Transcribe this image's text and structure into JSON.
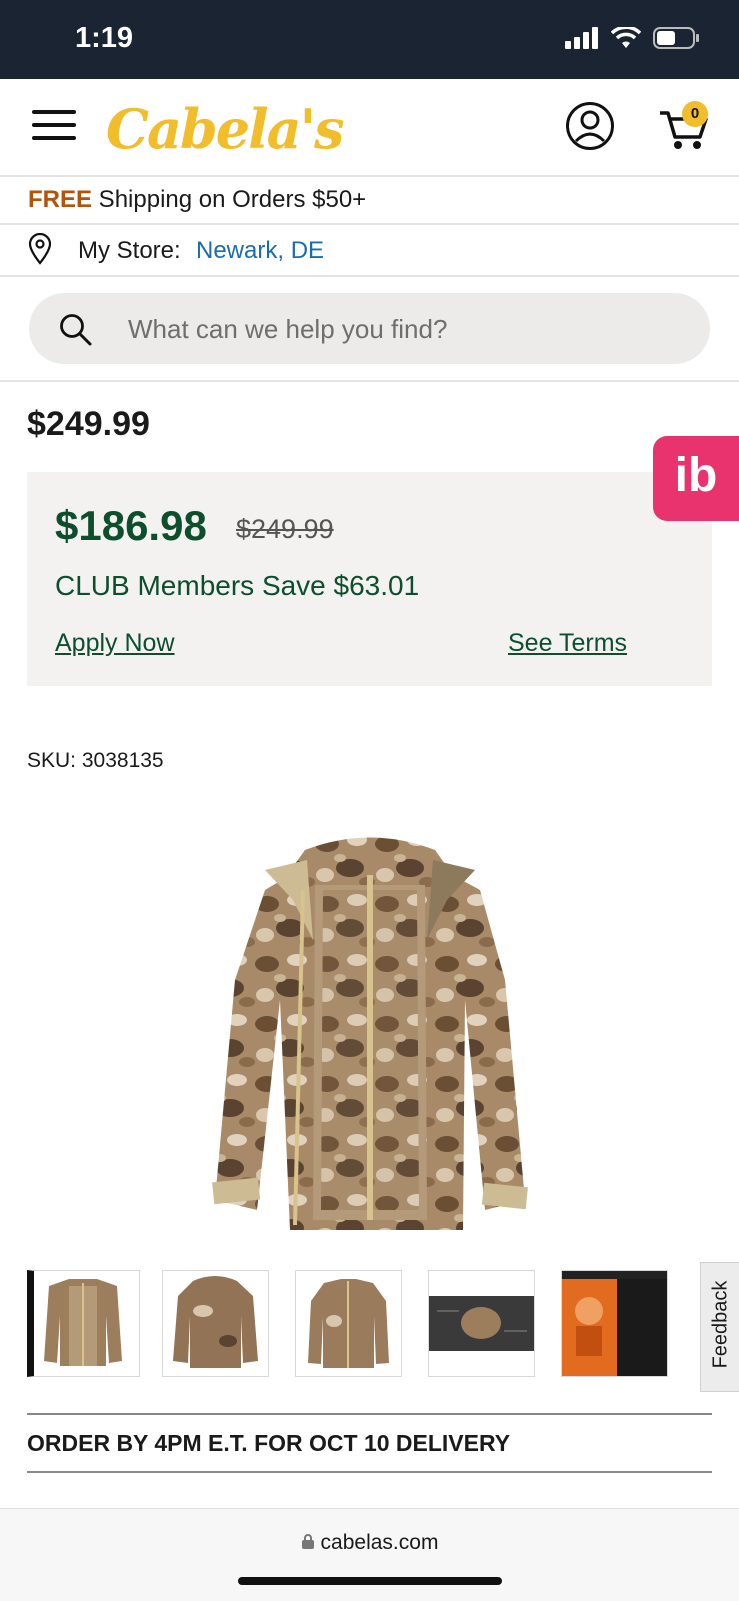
{
  "status": {
    "time": "1:19"
  },
  "header": {
    "logo": "Cabela's",
    "cart_count": "0"
  },
  "shipping": {
    "free": "FREE",
    "text": " Shipping on Orders $50+"
  },
  "store": {
    "label": "My Store:",
    "name": "Newark, DE"
  },
  "search": {
    "placeholder": "What can we help you find?"
  },
  "product": {
    "price": "$249.99",
    "club_price": "$186.98",
    "original_price": "$249.99",
    "club_savings": "CLUB Members Save $63.01",
    "apply_link": "Apply Now",
    "terms_link": "See Terms",
    "sku": "SKU: 3038135",
    "thumbnails": [
      "thumbnail-1",
      "thumbnail-2",
      "thumbnail-3",
      "thumbnail-4",
      "thumbnail-5"
    ]
  },
  "ib_badge": "ib",
  "feedback": "Feedback",
  "delivery": "ORDER BY 4PM E.T. FOR OCT 10 DELIVERY",
  "browser": {
    "url": "cabelas.com"
  },
  "colors": {
    "club_green": "#0d4f2d",
    "brand_gold": "#f1bd2b",
    "free_orange": "#b2540b",
    "link_blue": "#1a6cb0",
    "ib_pink": "#e8336e"
  }
}
